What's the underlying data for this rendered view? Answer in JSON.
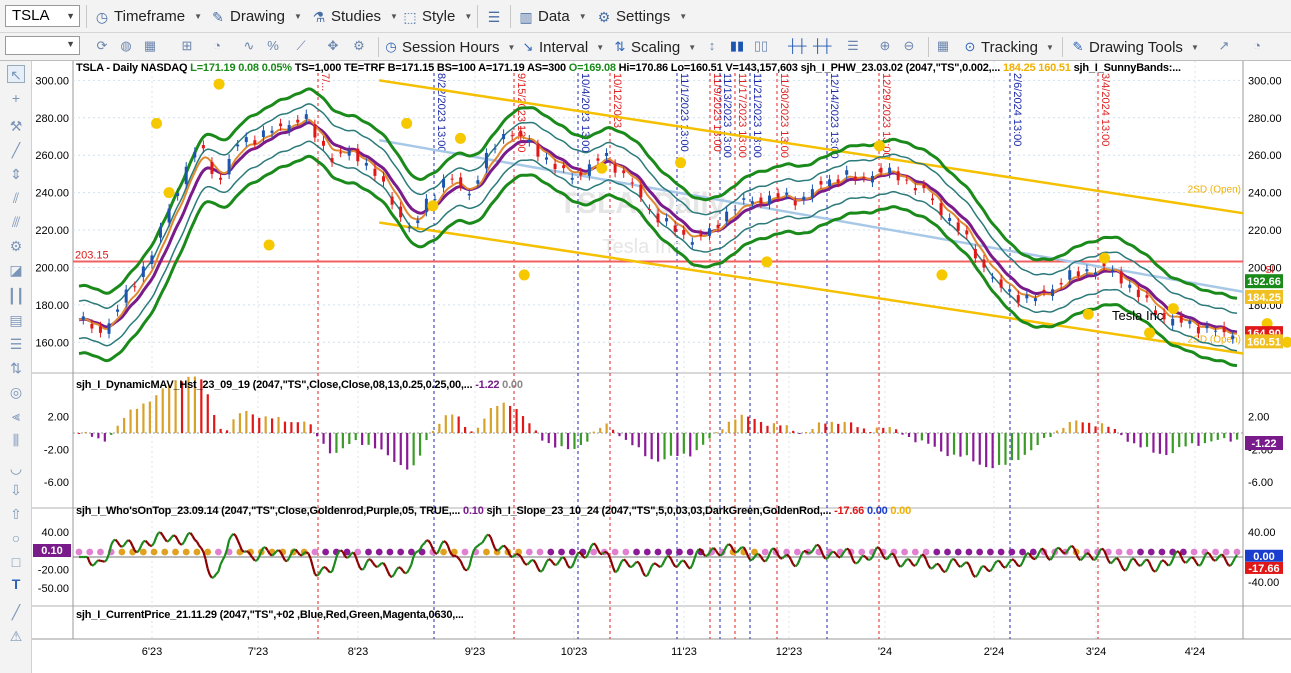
{
  "toolbar": {
    "symbol": "TSLA",
    "timeframe": "Timeframe",
    "drawing": "Drawing",
    "studies": "Studies",
    "style": "Style",
    "data": "Data",
    "settings": "Settings",
    "session_hours": "Session Hours",
    "interval": "Interval",
    "scaling": "Scaling",
    "tracking": "Tracking",
    "drawing_tools": "Drawing Tools"
  },
  "header": {
    "symbol_info": "TSLA - Daily  NASDAQ",
    "last": "L=171.19",
    "chg": "0.08",
    "pct": "0.05%",
    "ts": "TS=1,000",
    "te": "TE=TRF",
    "bid": "B=171.15",
    "bs": "BS=100",
    "ask": "A=171.19",
    "as": "AS=300",
    "open": "O=169.08",
    "hi": "Hi=170.86",
    "lo": "Lo=160.51",
    "vol": "V=143,157,603",
    "study1": "sjh_I_PHW_23.03.02 (2047,\"TS\",0.002,...",
    "study1_v1": "184.25",
    "study1_v2": "160.51",
    "study2": "sjh_I_SunnyBands:..."
  },
  "panes": {
    "p2_label": "sjh_I_DynamicMAV_Hst_23_09_19 (2047,\"TS\",Close,Close,08,13,0.25,0.25,00,...",
    "p2_v1": "-1.22",
    "p2_v2": "0.00",
    "p3_label": "sjh_I_Who'sOnTop_23.09.14 (2047,\"TS\",Close,Goldenrod,Purple,05,  TRUE,...",
    "p3_v1": "0.10",
    "p3_label2": "sjh_I_Slope_23_10_24 (2047,\"TS\",5,0,03,03,DarkGreen,GoldenRod,...",
    "p3_v2": "-17.66",
    "p3_v3": "0.00",
    "p3_v4": "0.00",
    "p4_label": "sjh_I_CurrentPrice_21.11.29 (2047,\"TS\",+02 ,Blue,Red,Green,Magenta,0630,..."
  },
  "price_axis": [
    "300.00",
    "280.00",
    "260.00",
    "240.00",
    "220.00",
    "200.00",
    "180.00",
    "160.00"
  ],
  "osc_axis": [
    "2.00",
    "-2.00",
    "-6.00"
  ],
  "slope_axis": [
    "40.00",
    "-20.00",
    "-50.00"
  ],
  "slope_axis_right": [
    "40.00",
    "-40.00"
  ],
  "x_labels": [
    "6'23",
    "7'23",
    "8'23",
    "9'23",
    "10'23",
    "11'23",
    "12'23",
    "'24",
    "2'24",
    "3'24",
    "4'24"
  ],
  "events": [
    {
      "label": "7/...",
      "color": "#e02020"
    },
    {
      "label": "8/22/2023 13:00",
      "color": "#1c2aa8"
    },
    {
      "label": "9/15/2023 13:00",
      "color": "#e02020"
    },
    {
      "label": "10/4/2023 13:00",
      "color": "#1c2aa8"
    },
    {
      "label": "10/12/2023",
      "color": "#e02020"
    },
    {
      "label": "11/1/2023 13:00",
      "color": "#1c2aa8"
    },
    {
      "label": "11/9/2023 13:00",
      "color": "#e02020"
    },
    {
      "label": "11/13/2023 13:00",
      "color": "#1c2aa8"
    },
    {
      "label": "11/17/2023 13:00",
      "color": "#e02020"
    },
    {
      "label": "11/21/2023 13:00",
      "color": "#1c2aa8"
    },
    {
      "label": "11/30/2023 13:00",
      "color": "#e02020"
    },
    {
      "label": "12/14/2023 13:00",
      "color": "#1c2aa8"
    },
    {
      "label": "12/29/2023 13:00",
      "color": "#e02020"
    },
    {
      "label": "2/6/2024 13:00",
      "color": "#1c2aa8"
    },
    {
      "label": "3/4/2024 13:00",
      "color": "#e02020"
    }
  ],
  "annotations": {
    "level_line": "203.15",
    "channel_label_upper": "2SD (Open)",
    "channel_label_lower": "2SD (Open)",
    "watermark_main": "TSLA, Daily",
    "watermark_sub": "Tesla Inc",
    "company_label": "Tesla Inc",
    "right_s": "Sl"
  },
  "price_tags": [
    {
      "value": "192.66",
      "color": "#1a8a1a"
    },
    {
      "value": "184.25",
      "color": "#f0c020"
    },
    {
      "value": "164.90",
      "color": "#e01818"
    },
    {
      "value": "160.51",
      "color": "#f0c020"
    }
  ],
  "osc_tag": {
    "value": "-1.22",
    "color": "#7a1b8c"
  },
  "slope_tags": [
    {
      "value": "0.10",
      "color": "#7a1b8c"
    },
    {
      "value": "0.00",
      "color": "#1a3fd0"
    },
    {
      "value": "-17.66",
      "color": "#e01818"
    }
  ],
  "colors": {
    "green": "#1a8a1a",
    "purple": "#7a1b8c",
    "gold": "#f0b000",
    "red": "#e01818",
    "blue": "#1c2aa8",
    "darkred": "#8b0000",
    "teal": "#2c7a7a",
    "lightblue": "#a8c8e8",
    "orange": "#e08a30"
  },
  "chart_data": {
    "type": "line",
    "title": "TSLA - Daily  NASDAQ",
    "x_range": [
      "2023-05-01",
      "2024-04-30"
    ],
    "ylim": [
      150,
      305
    ],
    "close_approx": [
      [
        0,
        172
      ],
      [
        10,
        165
      ],
      [
        18,
        178
      ],
      [
        25,
        190
      ],
      [
        35,
        210
      ],
      [
        45,
        240
      ],
      [
        55,
        265
      ],
      [
        60,
        258
      ],
      [
        65,
        245
      ],
      [
        75,
        268
      ],
      [
        85,
        270
      ],
      [
        95,
        276
      ],
      [
        105,
        280
      ],
      [
        112,
        268
      ],
      [
        118,
        258
      ],
      [
        128,
        262
      ],
      [
        138,
        250
      ],
      [
        148,
        232
      ],
      [
        155,
        218
      ],
      [
        162,
        235
      ],
      [
        172,
        248
      ],
      [
        182,
        240
      ],
      [
        192,
        262
      ],
      [
        200,
        274
      ],
      [
        210,
        266
      ],
      [
        218,
        258
      ],
      [
        228,
        248
      ],
      [
        236,
        252
      ],
      [
        245,
        260
      ],
      [
        252,
        252
      ],
      [
        258,
        244
      ],
      [
        265,
        232
      ],
      [
        275,
        222
      ],
      [
        285,
        215
      ],
      [
        294,
        218
      ],
      [
        304,
        232
      ],
      [
        315,
        236
      ],
      [
        326,
        238
      ],
      [
        336,
        236
      ],
      [
        346,
        244
      ],
      [
        356,
        250
      ],
      [
        364,
        246
      ],
      [
        372,
        252
      ],
      [
        384,
        248
      ],
      [
        394,
        240
      ],
      [
        404,
        228
      ],
      [
        412,
        218
      ],
      [
        420,
        204
      ],
      [
        428,
        190
      ],
      [
        436,
        186
      ],
      [
        444,
        182
      ],
      [
        452,
        188
      ],
      [
        460,
        194
      ],
      [
        468,
        198
      ],
      [
        476,
        200
      ],
      [
        484,
        196
      ],
      [
        492,
        188
      ],
      [
        500,
        178
      ],
      [
        508,
        172
      ],
      [
        516,
        170
      ],
      [
        524,
        168
      ],
      [
        532,
        165
      ],
      [
        540,
        164
      ]
    ],
    "series": [
      {
        "name": "2SD (Open)",
        "values": []
      }
    ]
  }
}
